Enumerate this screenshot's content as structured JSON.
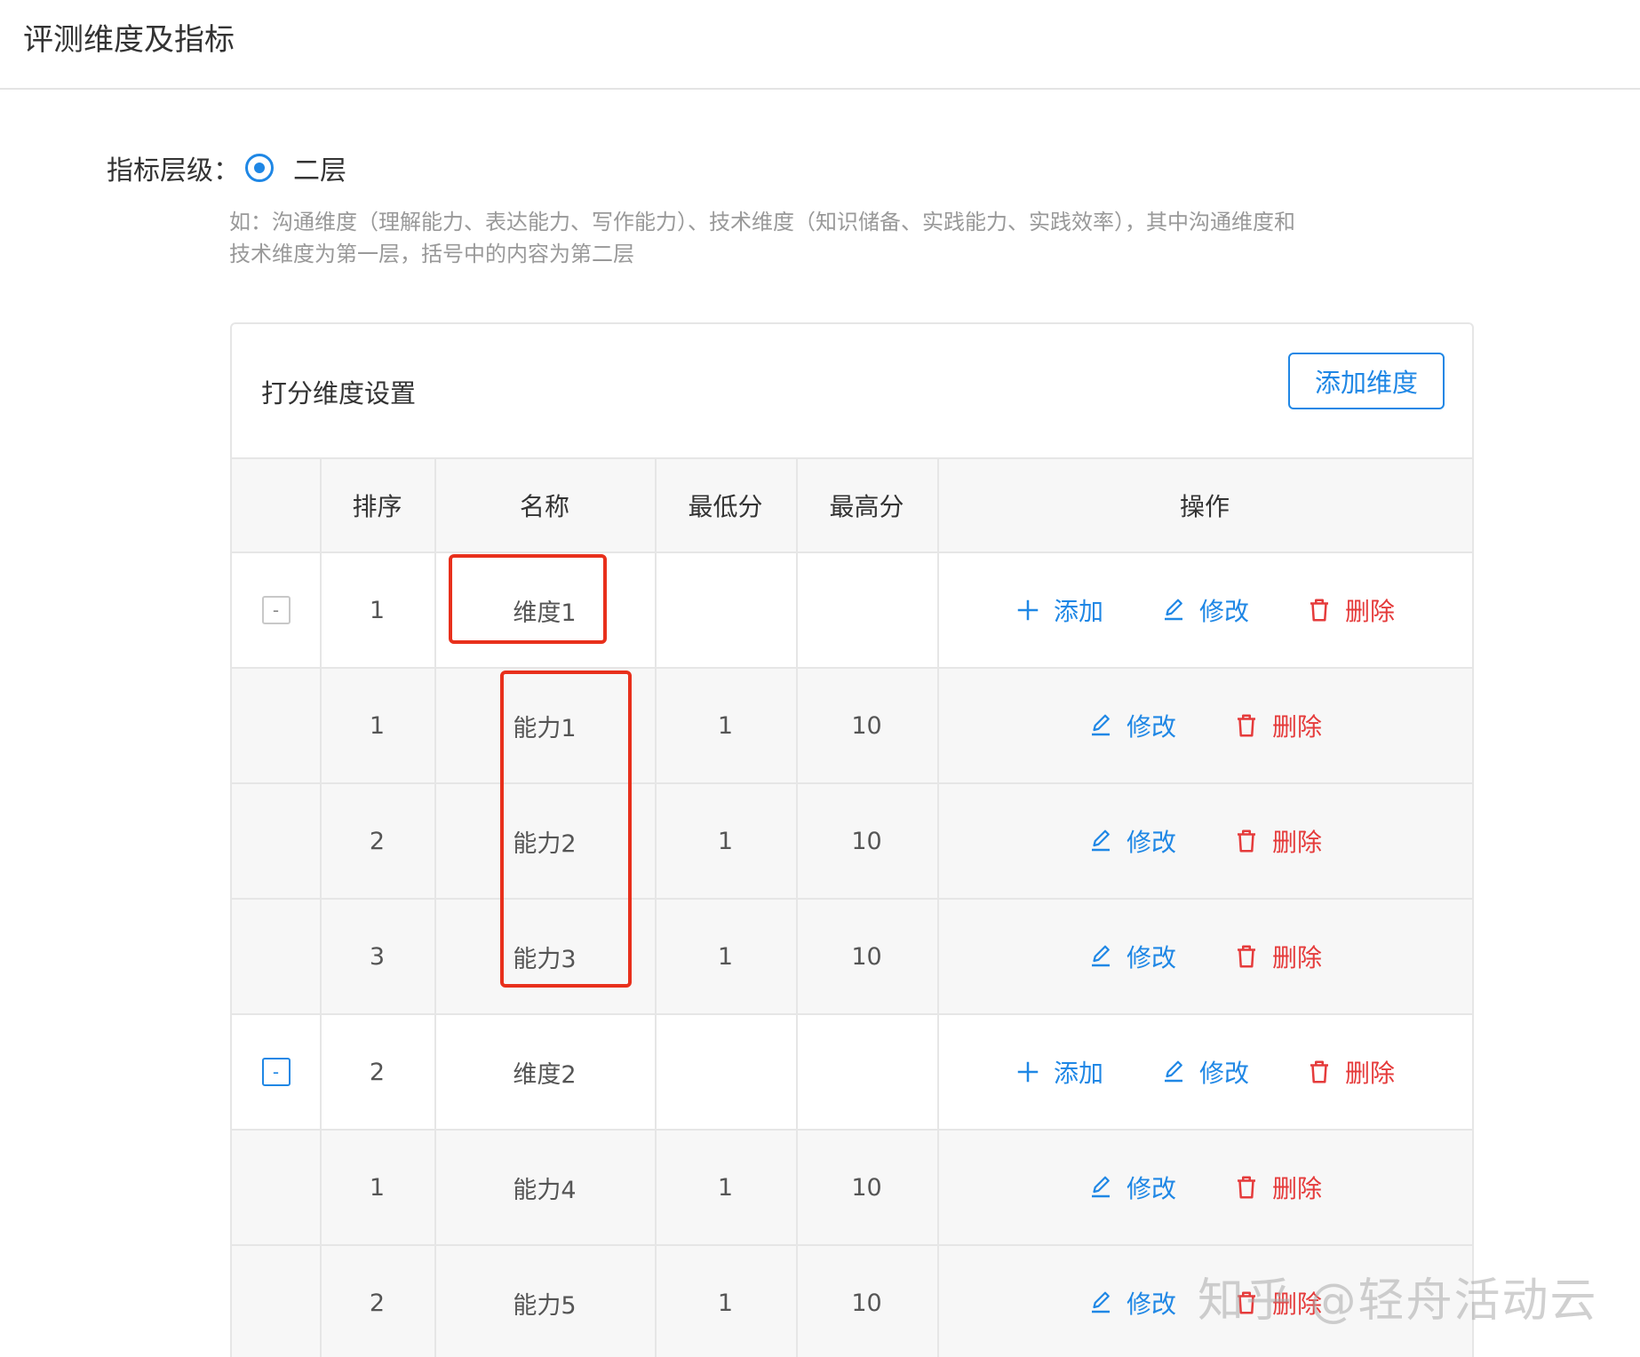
{
  "header": {
    "title": "评测维度及指标"
  },
  "level": {
    "label": "指标层级：",
    "option": "二层"
  },
  "hint": "如：沟通维度（理解能力、表达能力、写作能力）、技术维度（知识储备、实践能力、实践效率），其中沟通维度和技术维度为第一层，括号中的内容为第二层",
  "panel": {
    "title": "打分维度设置",
    "add_button": "添加维度"
  },
  "table": {
    "headers": [
      "排序",
      "名称",
      "最低分",
      "最高分",
      "操作"
    ],
    "actions": {
      "add": "添加",
      "edit": "修改",
      "delete": "删除"
    },
    "toggle_symbol": "-",
    "dimensions": [
      {
        "order": "1",
        "name": "维度1",
        "children": [
          {
            "order": "1",
            "name": "能力1",
            "min": "1",
            "max": "10"
          },
          {
            "order": "2",
            "name": "能力2",
            "min": "1",
            "max": "10"
          },
          {
            "order": "3",
            "name": "能力3",
            "min": "1",
            "max": "10"
          }
        ]
      },
      {
        "order": "2",
        "name": "维度2",
        "children": [
          {
            "order": "1",
            "name": "能力4",
            "min": "1",
            "max": "10"
          },
          {
            "order": "2",
            "name": "能力5",
            "min": "1",
            "max": "10"
          }
        ]
      }
    ]
  },
  "colors": {
    "accent": "#1f87e5",
    "danger": "#e53b3b",
    "highlight": "#e8301c"
  },
  "icons": {
    "add": "plus-icon",
    "edit": "pencil-icon",
    "delete": "trash-icon"
  },
  "watermark": "知乎 @轻舟活动云"
}
